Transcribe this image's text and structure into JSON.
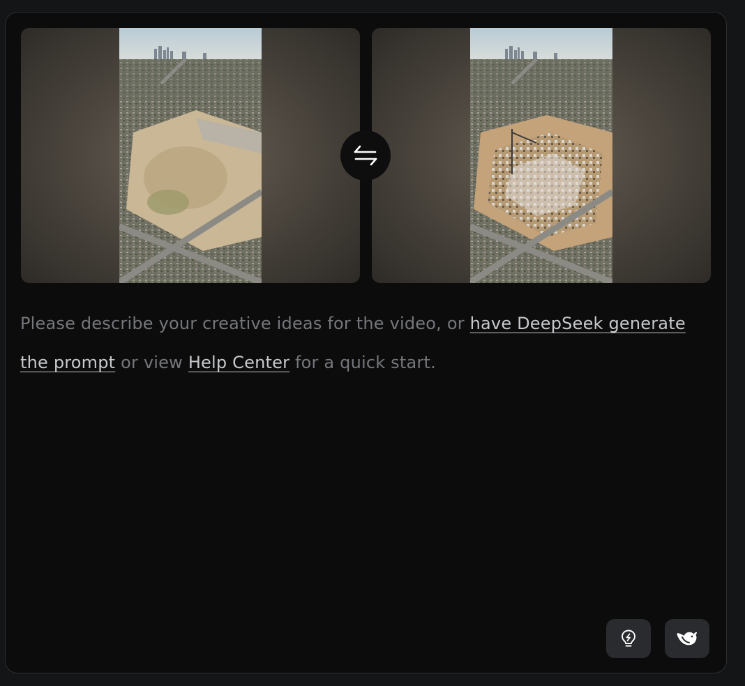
{
  "frames": {
    "first_frame": {
      "icon": "aerial-empty-lot-image"
    },
    "last_frame": {
      "icon": "aerial-construction-site-image"
    },
    "swap": {
      "icon": "swap-arrows-icon"
    }
  },
  "prompt": {
    "text_1": "Please describe your creative ideas for the video, or ",
    "link_deepseek": "have DeepSeek generate the prompt",
    "text_2": " or view ",
    "link_help": "Help Center",
    "text_3": " for a quick start."
  },
  "toolbar": {
    "inspiration_icon": "lightbulb-bolt-icon",
    "deepseek_icon": "deepseek-whale-icon"
  },
  "colors": {
    "page_bg": "#141517",
    "panel_bg": "#0c0c0d",
    "button_bg": "#292b2e",
    "placeholder_text": "#75777b",
    "link_text": "#c7c9cc"
  }
}
